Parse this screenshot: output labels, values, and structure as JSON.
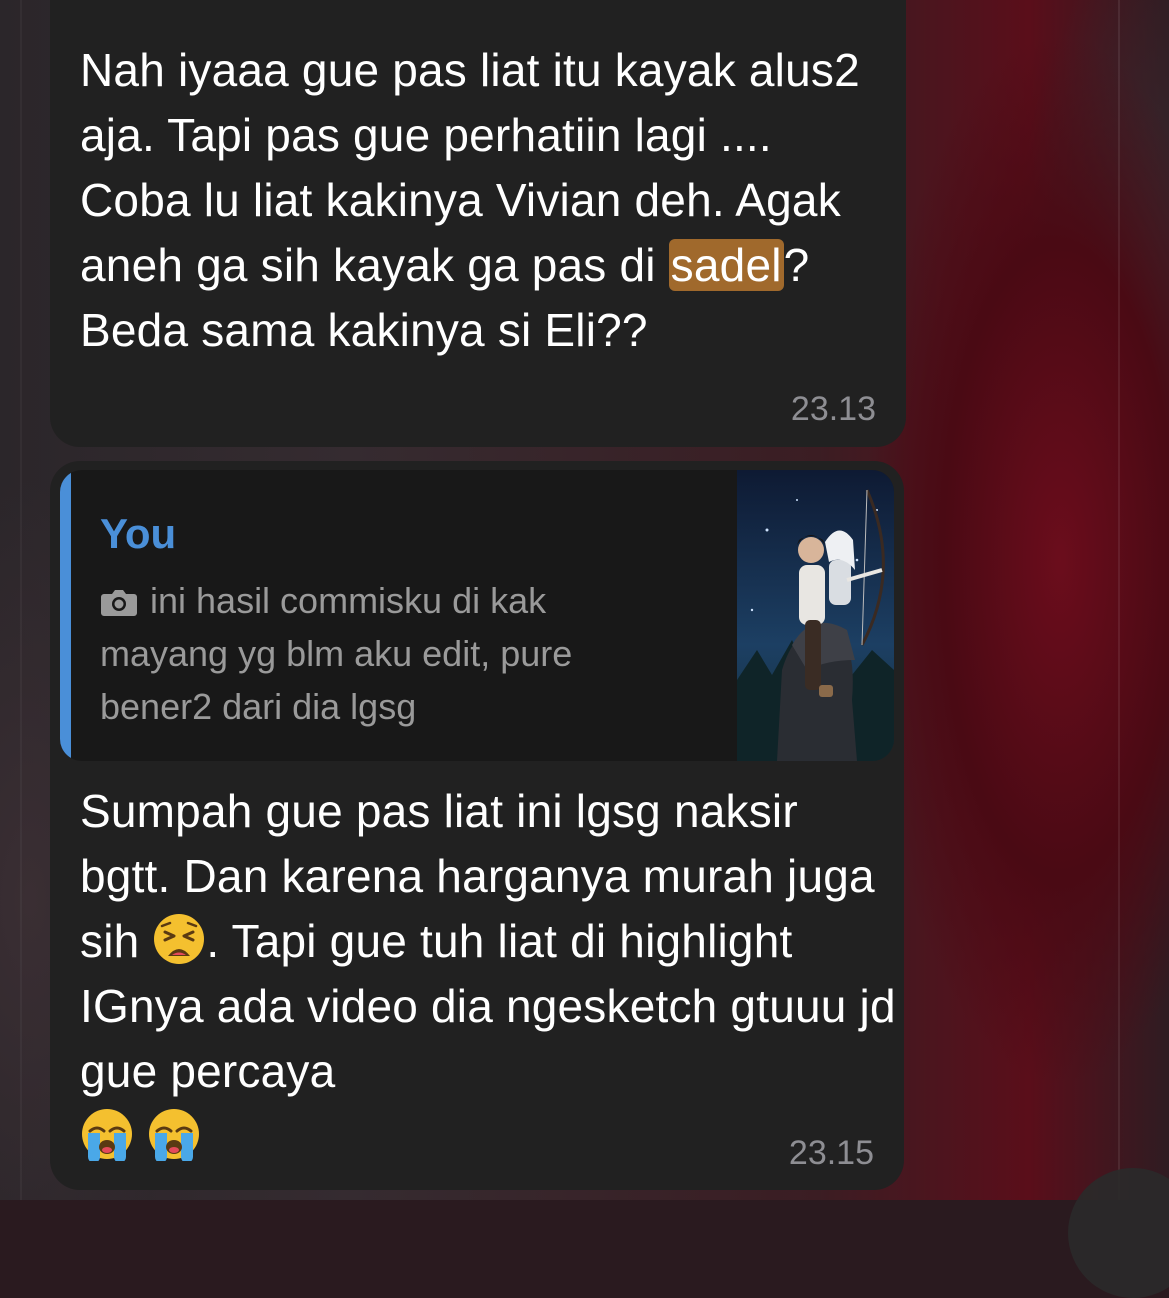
{
  "messages": [
    {
      "text_before": "Nah iyaaa gue pas liat itu kayak alus2 aja. Tapi pas gue perhatiin lagi .... Coba lu liat kakinya Vivian deh. Agak aneh ga sih kayak ga pas di ",
      "highlight": "sadel",
      "text_after": "? Beda sama kakinya si Eli??",
      "time": "23.13"
    },
    {
      "reply": {
        "author": "You",
        "media_icon": "camera-icon",
        "text": "ini hasil commisku di kak mayang yg blm aku edit, pure bener2 dari dia lgsg",
        "thumbnail": "illustration-thumbnail"
      },
      "text_part1": "Sumpah gue pas liat ini lgsg naksir bgtt. Dan karena harganya murah juga sih ",
      "emoji_1": "weary-face-emoji",
      "text_part2": ". Tapi gue tuh liat di highlight IGnya ada video dia ngesketch gtuuu jd gue percaya",
      "emoji_2": "loudly-crying-face-emoji",
      "time": "23.15"
    }
  ],
  "colors": {
    "bubble": "#212121",
    "reply_accent": "#4a8fd8",
    "search_highlight": "#a0692c",
    "timestamp": "#8e8e93"
  }
}
